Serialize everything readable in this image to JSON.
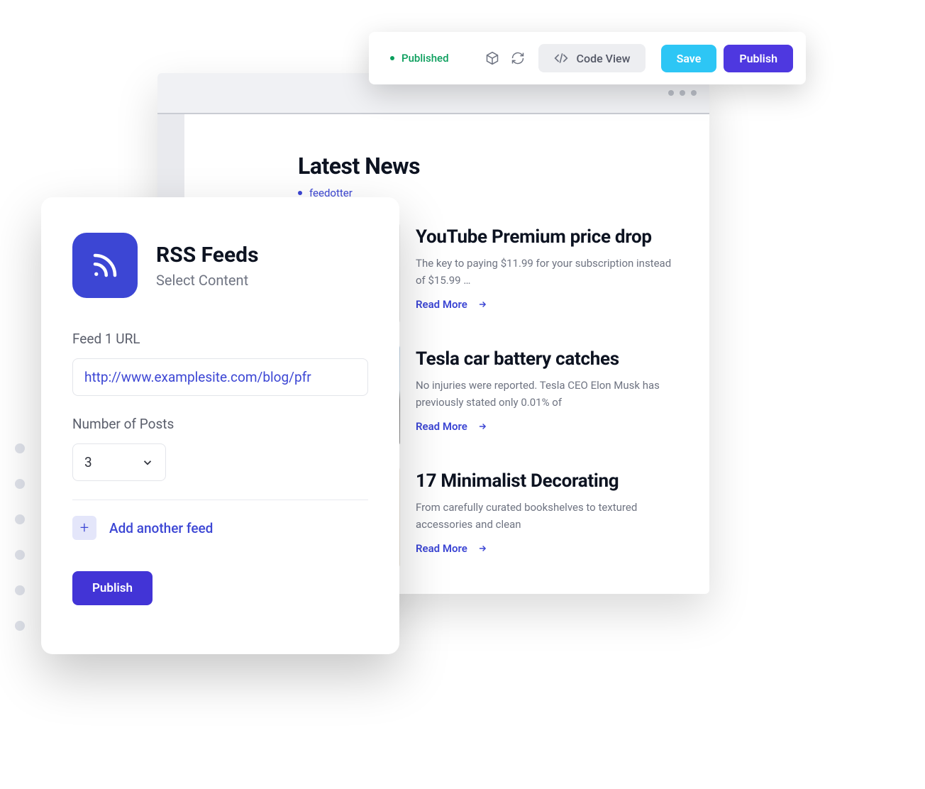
{
  "toolbar": {
    "status": "Published",
    "code_view_label": "Code View",
    "save_label": "Save",
    "publish_label": "Publish"
  },
  "preview": {
    "heading": "Latest News",
    "tag": "feedotter",
    "read_more_label": "Read More",
    "articles": [
      {
        "title": "YouTube Premium price drop",
        "excerpt": "The key to paying $11.99 for your subscription instead of $15.99 …"
      },
      {
        "title": "Tesla car battery catches",
        "excerpt": "No injuries were reported. Tesla CEO Elon Musk has previously stated only 0.01% of"
      },
      {
        "title": "17 Minimalist Decorating",
        "excerpt": "From carefully curated bookshelves to textured accessories and clean"
      }
    ]
  },
  "rss": {
    "title": "RSS Feeds",
    "subtitle": "Select Content",
    "feed_url_label": "Feed 1 URL",
    "feed_url_value": "http://www.examplesite.com/blog/pfr",
    "num_posts_label": "Number of Posts",
    "num_posts_value": "3",
    "add_feed_label": "Add another feed",
    "publish_label": "Publish"
  }
}
